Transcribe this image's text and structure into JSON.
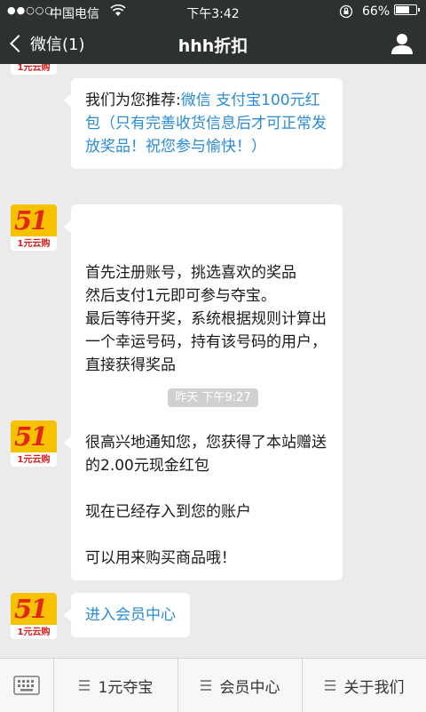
{
  "status_bar": {
    "signal": "●●○○○",
    "carrier": "中国电信",
    "wifi_icon": "wifi-icon",
    "time": "下午3:42",
    "battery_pct": "66%",
    "battery_level": 0.66
  },
  "nav": {
    "back_label": "微信(1)",
    "title": "hhh折扣",
    "profile_icon": "person-icon"
  },
  "messages": [
    {
      "lines_pre": "我们为您推荐:",
      "link": "微信 支付宝100元红包（只有完善收货信息后才可正常发放奖品！祝您参与愉快！）"
    },
    {
      "text": "首先注册账号，挑选喜欢的奖品\n然后支付1元即可参与夺宝。\n最后等待开奖，系统根据规则计算出一个幸运号码，持有该号码的用户，直接获得奖品"
    },
    {
      "p1": "很高兴地通知您，您获得了本站赠送的2.00元现金红包",
      "p2": "现在已经存入到您的账户",
      "p3": "可以用来购买商品哦！"
    },
    {
      "link": "进入会员中心"
    }
  ],
  "timestamp": "昨天 下午9:27",
  "avatar": {
    "big": "51",
    "sub": "1元云购"
  },
  "bottom_menu": {
    "keyboard_icon": "keyboard-icon",
    "items": [
      "1元夺宝",
      "会员中心",
      "关于我们"
    ]
  }
}
